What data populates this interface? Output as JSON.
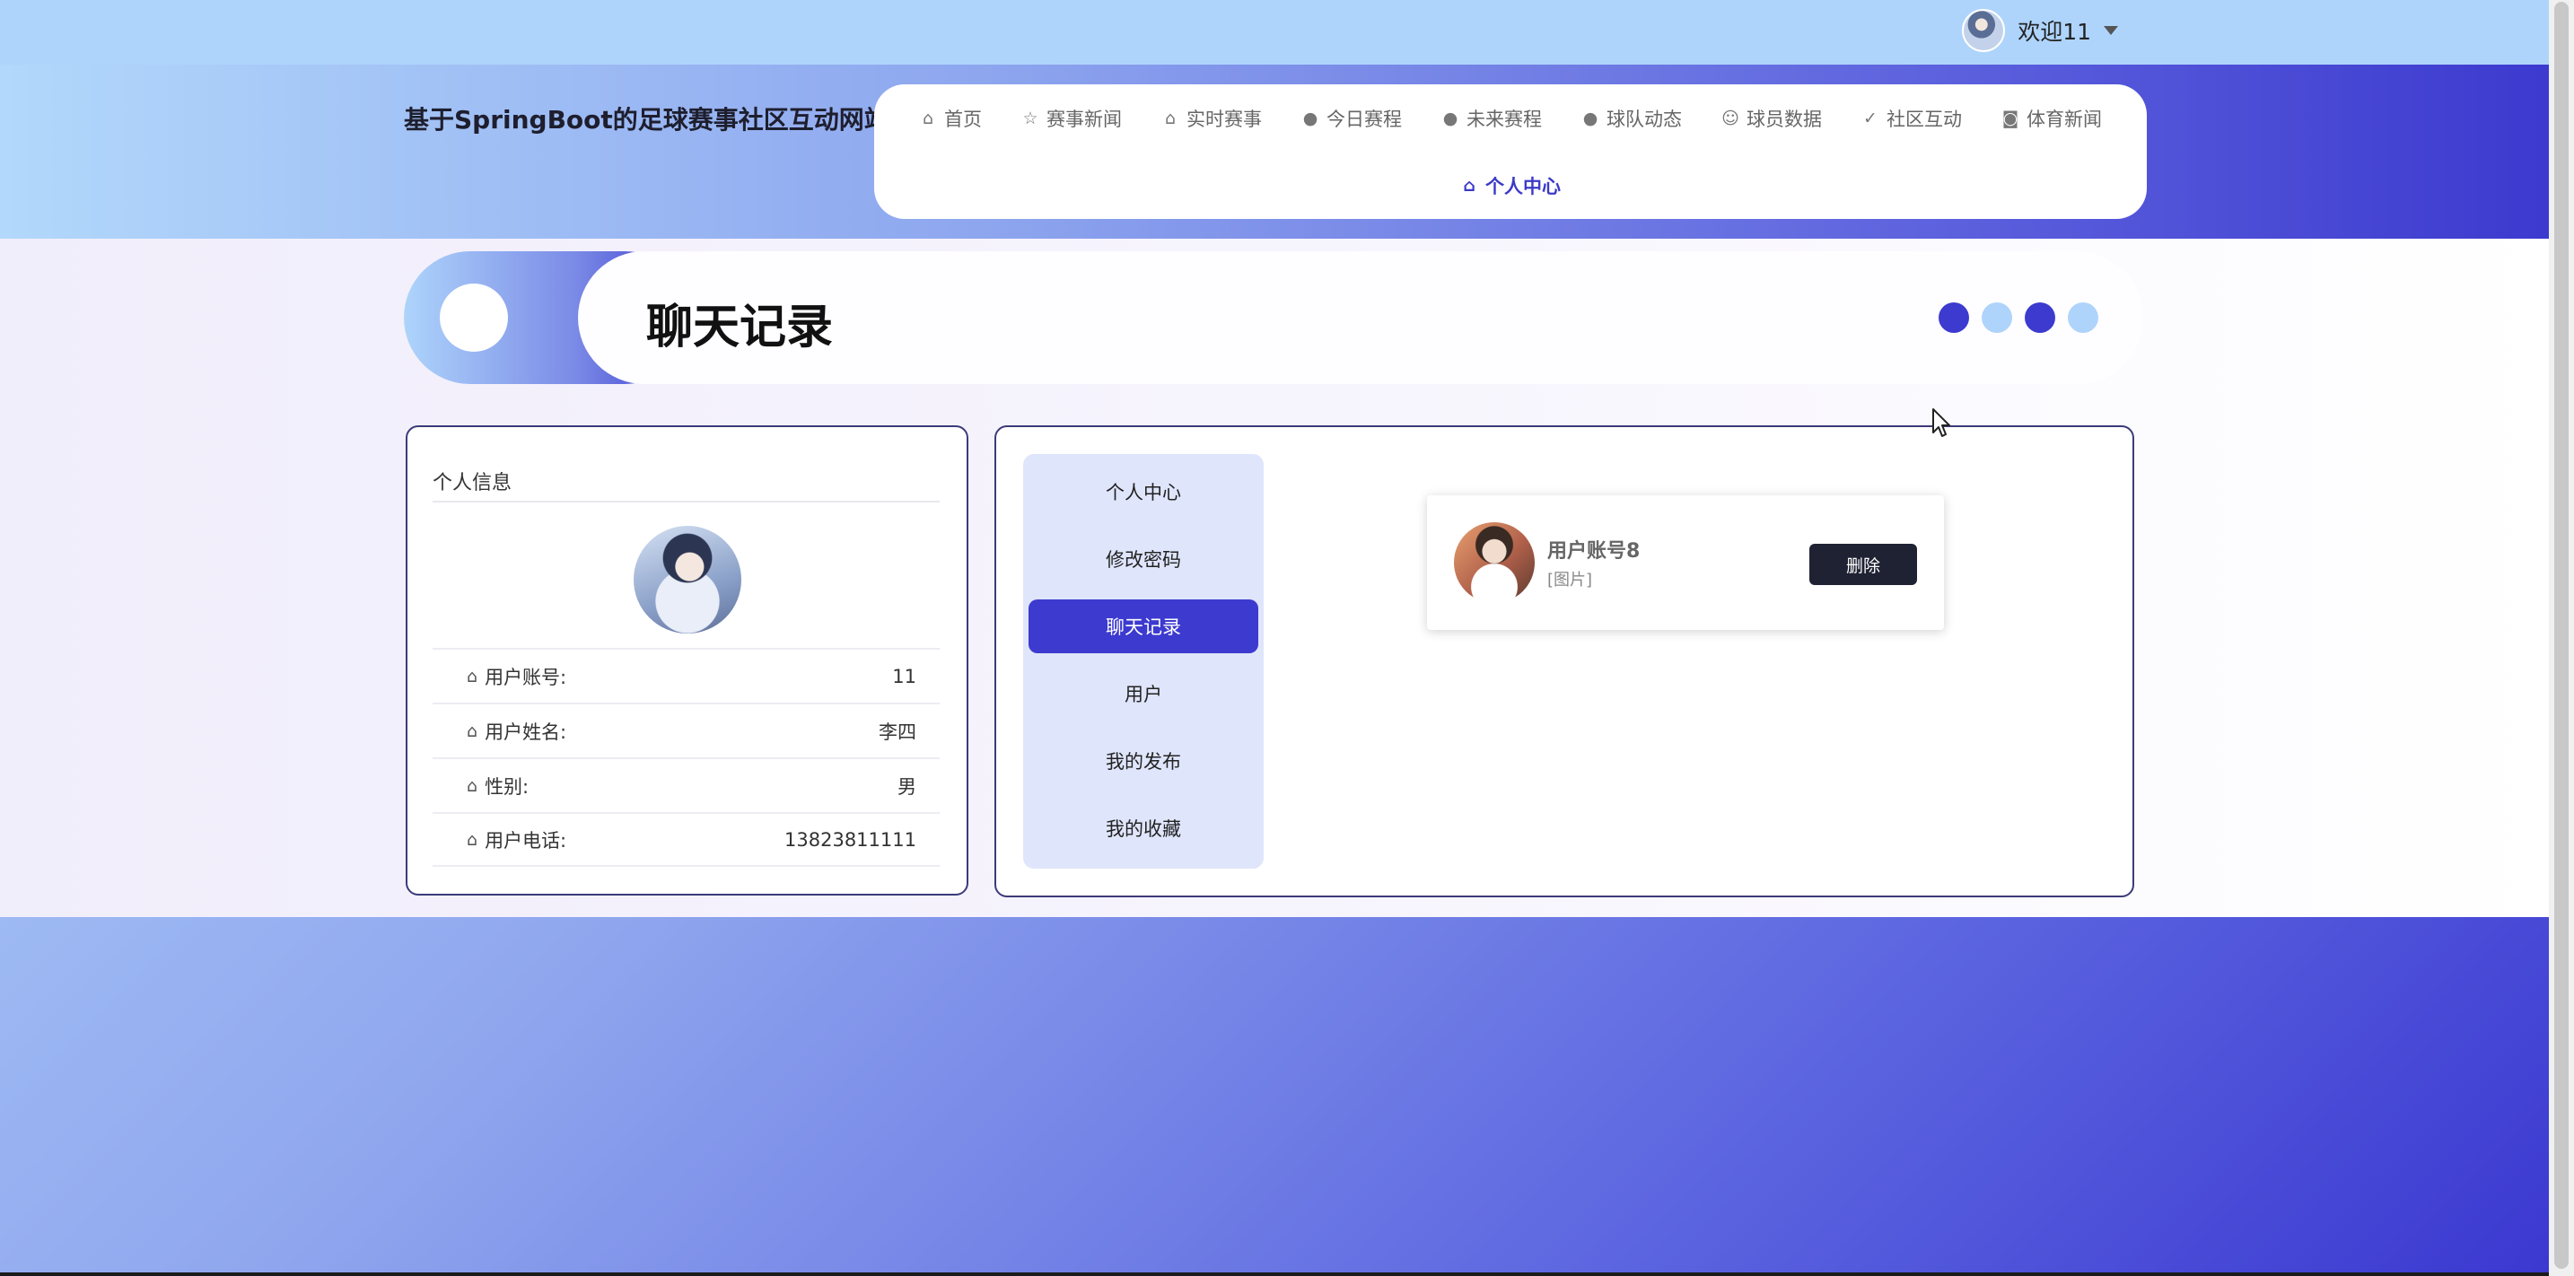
{
  "topbar": {
    "welcome": "欢迎11"
  },
  "header": {
    "site_title": "基于SpringBoot的足球赛事社区互动网站",
    "nav_items": [
      {
        "label": "首页",
        "icon": "home-icon"
      },
      {
        "label": "赛事新闻",
        "icon": "star-icon"
      },
      {
        "label": "实时赛事",
        "icon": "bag-icon"
      },
      {
        "label": "今日赛程",
        "icon": "warning-icon"
      },
      {
        "label": "未来赛程",
        "icon": "question-icon"
      },
      {
        "label": "球队动态",
        "icon": "info-icon"
      },
      {
        "label": "球员数据",
        "icon": "smile-icon"
      },
      {
        "label": "社区互动",
        "icon": "check-circle-icon"
      },
      {
        "label": "体育新闻",
        "icon": "camera-icon"
      }
    ],
    "nav_active": {
      "label": "个人中心",
      "icon": "home-icon"
    }
  },
  "banner": {
    "title": "聊天记录",
    "dot_colors": [
      "#3c3acf",
      "#aed4fb",
      "#3c3acf",
      "#aed4fb"
    ]
  },
  "profile": {
    "heading": "个人信息",
    "rows": [
      {
        "label": "用户账号:",
        "value": "11"
      },
      {
        "label": "用户姓名:",
        "value": "李四"
      },
      {
        "label": "性别:",
        "value": "男"
      },
      {
        "label": "用户电话:",
        "value": "13823811111"
      }
    ]
  },
  "side_menu": {
    "items": [
      "个人中心",
      "修改密码",
      "聊天记录",
      "用户",
      "我的发布",
      "我的收藏"
    ],
    "active": "聊天记录"
  },
  "chat": {
    "name": "用户账号8",
    "message": "[图片]",
    "delete_label": "删除"
  },
  "colors": {
    "accent": "#3c3acf",
    "light_blue": "#aed4fb",
    "dark_button": "#1f2233"
  }
}
